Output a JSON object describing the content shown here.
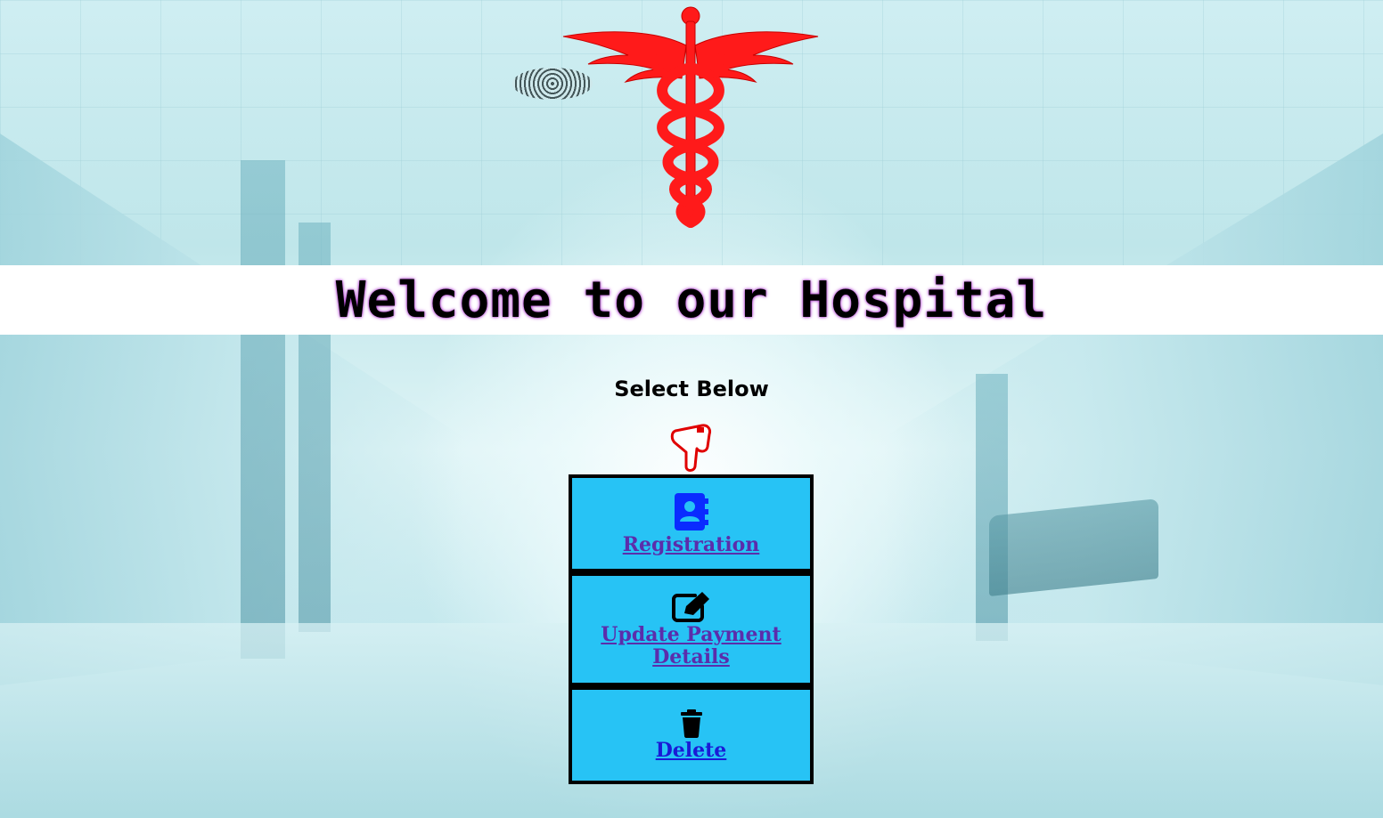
{
  "header": {
    "title": "Welcome to our Hospital"
  },
  "prompt": {
    "text": "Select Below"
  },
  "menu": {
    "items": [
      {
        "label": "Registration",
        "icon": "contact-book-icon"
      },
      {
        "label": "Update Payment Details",
        "icon": "edit-icon"
      },
      {
        "label": "Delete",
        "icon": "trash-icon"
      }
    ]
  },
  "colors": {
    "logo": "#ff1a1a",
    "menu_bg": "#27c3f5",
    "link": "#5b2dab",
    "title_glow": "#b040d0"
  }
}
